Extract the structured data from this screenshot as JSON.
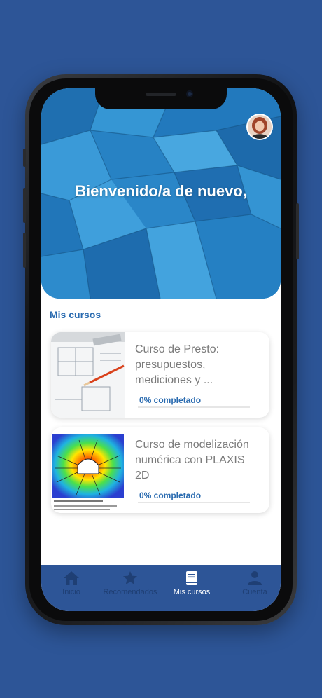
{
  "hero": {
    "welcome": "Bienvenido/a de nuevo,"
  },
  "section": {
    "title": "Mis cursos"
  },
  "courses": [
    {
      "title": "Curso de Presto: presupuestos, mediciones y ...",
      "progress": "0% completado",
      "progress_value": 0
    },
    {
      "title": "Curso de modelización numérica con PLAXIS 2D",
      "progress": "0% completado",
      "progress_value": 0
    }
  ],
  "nav": [
    {
      "label": "Inicio",
      "icon": "home-icon"
    },
    {
      "label": "Recomendados",
      "icon": "star-icon"
    },
    {
      "label": "Mis cursos",
      "icon": "book-icon",
      "active": true
    },
    {
      "label": "Cuenta",
      "icon": "user-icon"
    }
  ],
  "colors": {
    "background": "#2d5597",
    "accent": "#2a6bb0",
    "nav_bg": "#2d5597"
  }
}
